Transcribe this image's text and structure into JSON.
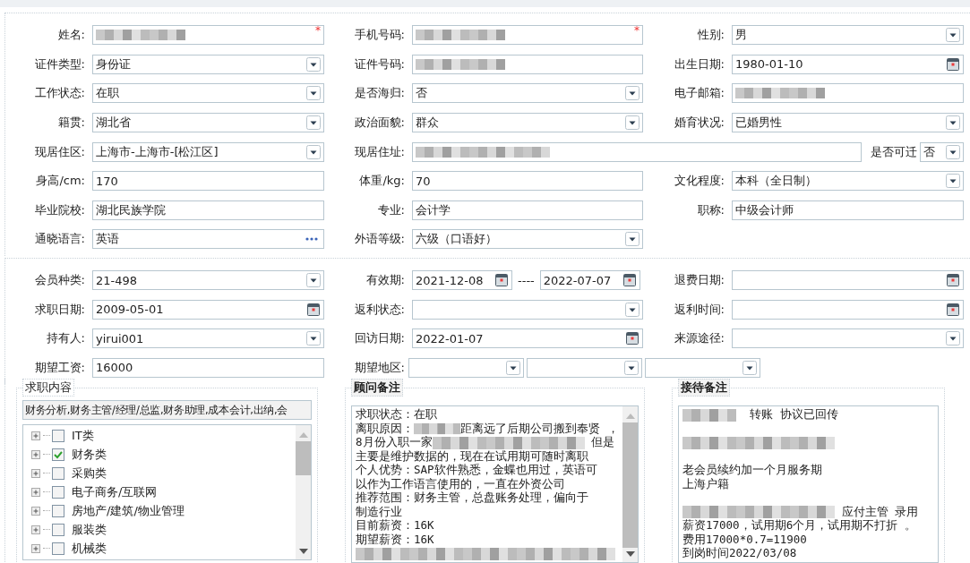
{
  "personal": {
    "rows": [
      [
        {
          "label": "姓名:",
          "kind": "redacted",
          "required_mark": "*"
        },
        {
          "label": "手机号码:",
          "kind": "redacted",
          "required_mark": "*"
        },
        {
          "label": "性别:",
          "kind": "select",
          "value": "男"
        }
      ],
      [
        {
          "label": "证件类型:",
          "kind": "select",
          "value": "身份证"
        },
        {
          "label": "证件号码:",
          "kind": "redacted"
        },
        {
          "label": "出生日期:",
          "kind": "date",
          "value": "1980-01-10"
        }
      ],
      [
        {
          "label": "工作状态:",
          "kind": "select",
          "value": "在职"
        },
        {
          "label": "是否海归:",
          "kind": "select",
          "value": "否"
        },
        {
          "label": "电子邮箱:",
          "kind": "redacted"
        }
      ],
      [
        {
          "label": "籍贯:",
          "kind": "select",
          "value": "湖北省"
        },
        {
          "label": "政治面貌:",
          "kind": "select",
          "value": "群众"
        },
        {
          "label": "婚育状况:",
          "kind": "select",
          "value": "已婚男性"
        }
      ],
      [
        {
          "label": "现居住区:",
          "kind": "select",
          "value": "上海市-上海市-[松江区]"
        },
        {
          "label": "现居住址:",
          "kind": "address",
          "relocate": {
            "label": "是否可迁",
            "value": "否"
          }
        }
      ],
      [
        {
          "label": "身高/cm:",
          "kind": "text",
          "value": "170"
        },
        {
          "label": "体重/kg:",
          "kind": "text",
          "value": "70"
        },
        {
          "label": "文化程度:",
          "kind": "select",
          "value": "本科（全日制）"
        }
      ],
      [
        {
          "label": "毕业院校:",
          "kind": "text",
          "value": "湖北民族学院"
        },
        {
          "label": "专业:",
          "kind": "text",
          "value": "会计学"
        },
        {
          "label": "职称:",
          "kind": "text",
          "value": "中级会计师"
        }
      ],
      [
        {
          "label": "通晓语言:",
          "kind": "picker",
          "value": "英语"
        },
        {
          "label": "外语等级:",
          "kind": "select",
          "value": "六级（口语好）"
        }
      ]
    ]
  },
  "membership": {
    "rows": [
      [
        {
          "label": "会员种类:",
          "kind": "select",
          "value": "21-498"
        },
        {
          "label": "有效期:",
          "kind": "range",
          "values": [
            "2021-12-08",
            "2022-07-07"
          ],
          "separator": "----"
        },
        {
          "label": "退费日期:",
          "kind": "date"
        }
      ],
      [
        {
          "label": "求职日期:",
          "kind": "date",
          "value": "2009-05-01"
        },
        {
          "label": "返利状态:",
          "kind": "select"
        },
        {
          "label": "返利时间:",
          "kind": "date"
        }
      ],
      [
        {
          "label": "持有人:",
          "kind": "select",
          "value": "yirui001"
        },
        {
          "label": "回访日期:",
          "kind": "date",
          "value": "2022-01-07"
        },
        {
          "label": "来源途径:",
          "kind": "select"
        }
      ],
      [
        {
          "label": "期望工资:",
          "kind": "text",
          "value": "16000"
        },
        {
          "label": "期望地区:",
          "kind": "multi_select",
          "selects": [
            {
              "kind": "select"
            },
            {
              "kind": "select"
            },
            {
              "kind": "select"
            }
          ]
        }
      ]
    ]
  },
  "job_content": {
    "title": "求职内容",
    "summary": "财务分析,财务主管/经理/总监,财务助理,成本会计,出纳,会",
    "tree": [
      {
        "label": "IT类",
        "checked": false
      },
      {
        "label": "财务类",
        "checked": true
      },
      {
        "label": "采购类",
        "checked": false
      },
      {
        "label": "电子商务/互联网",
        "checked": false
      },
      {
        "label": "房地产/建筑/物业管理",
        "checked": false
      },
      {
        "label": "服装类",
        "checked": false
      },
      {
        "label": "机械类",
        "checked": false
      }
    ]
  },
  "consultant_notes": {
    "title": "顾问备注",
    "lines": [
      {
        "kind": "content",
        "segments": [
          {
            "kind": "text",
            "text": "求职状态：在职"
          }
        ]
      },
      {
        "kind": "content",
        "segments": [
          {
            "kind": "text",
            "text": "离职原因："
          },
          {
            "kind": "redacted_word"
          },
          {
            "kind": "text",
            "text": "距离远了后期公司搬到奉贤 ，"
          }
        ]
      },
      {
        "kind": "content",
        "segments": [
          {
            "kind": "text",
            "text": "8月份入职一家"
          },
          {
            "kind": "redacted_phrase"
          },
          {
            "kind": "text",
            "text": " 但是"
          }
        ]
      },
      {
        "kind": "content",
        "segments": [
          {
            "kind": "text",
            "text": "主要是维护数据的，现在在试用期可随时离职"
          }
        ]
      },
      {
        "kind": "content",
        "segments": [
          {
            "kind": "text",
            "text": "个人优势：SAP软件熟悉，金蝶也用过，英语可"
          }
        ]
      },
      {
        "kind": "content",
        "segments": [
          {
            "kind": "text",
            "text": "以作为工作语言使用的，一直在外资公司"
          }
        ]
      },
      {
        "kind": "content",
        "segments": [
          {
            "kind": "text",
            "text": "推荐范围：财务主管，总盘账务处理，偏向于"
          }
        ]
      },
      {
        "kind": "content",
        "segments": [
          {
            "kind": "text",
            "text": "制造行业"
          }
        ]
      },
      {
        "kind": "content",
        "segments": [
          {
            "kind": "text",
            "text": "目前薪资：16K"
          }
        ]
      },
      {
        "kind": "content",
        "segments": [
          {
            "kind": "text",
            "text": "期望薪资：16K"
          }
        ]
      },
      {
        "kind": "content",
        "segments": [
          {
            "kind": "redacted_line"
          }
        ]
      }
    ]
  },
  "reception_notes": {
    "title": "接待备注",
    "lines": [
      {
        "kind": "content",
        "segments": [
          {
            "kind": "redacted_word"
          },
          {
            "kind": "text",
            "text": "  转账 协议已回传"
          }
        ]
      },
      {
        "kind": "blank"
      },
      {
        "kind": "content",
        "segments": [
          {
            "kind": "redacted_phrase"
          }
        ]
      },
      {
        "kind": "blank"
      },
      {
        "kind": "content",
        "segments": [
          {
            "kind": "text",
            "text": "老会员续约加一个月服务期"
          }
        ]
      },
      {
        "kind": "content",
        "segments": [
          {
            "kind": "text",
            "text": "上海户籍"
          }
        ]
      },
      {
        "kind": "blank"
      },
      {
        "kind": "content",
        "segments": [
          {
            "kind": "redacted_phrase"
          },
          {
            "kind": "text",
            "text": " 应付主管 录用"
          }
        ]
      },
      {
        "kind": "content",
        "segments": [
          {
            "kind": "text",
            "text": "薪资17000，试用期6个月，试用期不打折 。"
          }
        ]
      },
      {
        "kind": "content",
        "segments": [
          {
            "kind": "text",
            "text": "费用17000*0.7=11900"
          }
        ]
      },
      {
        "kind": "content",
        "segments": [
          {
            "kind": "text",
            "text": "到岗时间2022/03/08"
          }
        ]
      }
    ]
  }
}
